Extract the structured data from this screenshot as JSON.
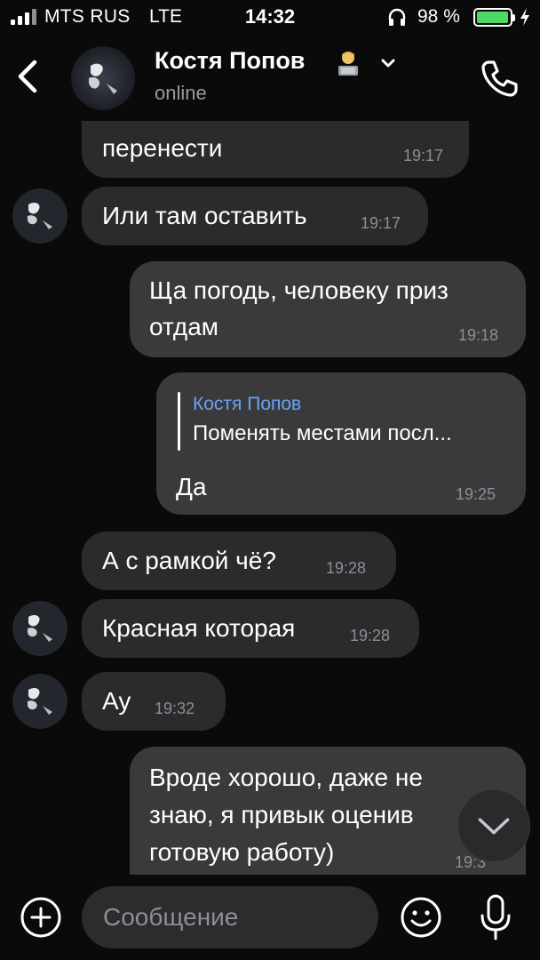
{
  "status_bar": {
    "carrier": "MTS RUS",
    "network": "LTE",
    "time": "14:32",
    "battery_percent": "98 %",
    "battery_level": 0.98,
    "icons": [
      "signal-icon",
      "headphones-icon",
      "battery-icon",
      "charging-icon"
    ]
  },
  "header": {
    "contact_name": "Костя Попов",
    "contact_status": "online",
    "emoji": "person-technologist-emoji",
    "icons": [
      "back-chevron-icon",
      "chevron-down-icon",
      "phone-icon"
    ]
  },
  "messages": [
    {
      "dir": "in",
      "text": "перенести",
      "time": "19:17"
    },
    {
      "dir": "in",
      "text": "Или там оставить",
      "time": "19:17"
    },
    {
      "dir": "out",
      "text_line1": "Ща погодь, человеку приз",
      "text_line2": "отдам",
      "time": "19:18"
    },
    {
      "dir": "out",
      "reply_author": "Костя Попов",
      "reply_text": "Поменять местами посл...",
      "text": "Да",
      "time": "19:25"
    },
    {
      "dir": "in",
      "text": "А с рамкой чё?",
      "time": "19:28"
    },
    {
      "dir": "in",
      "text": "Красная которая",
      "time": "19:28"
    },
    {
      "dir": "in",
      "text": "Ау",
      "time": "19:32"
    },
    {
      "dir": "out",
      "text_line1": "Вроде хорошо, даже не",
      "text_line2": "знаю, я привык оценив",
      "text_line3": "готовую работу)",
      "time": "19:3"
    }
  ],
  "input": {
    "placeholder": "Сообщение",
    "icons": [
      "plus-icon",
      "emoji-icon",
      "microphone-icon"
    ]
  },
  "colors": {
    "background": "#0a0a0a",
    "bubble_in": "#2b2b2d",
    "bubble_out": "#3a3a3c",
    "accent_link": "#6ba3f5",
    "battery": "#4cd964",
    "time_text": "#8e8e93"
  }
}
